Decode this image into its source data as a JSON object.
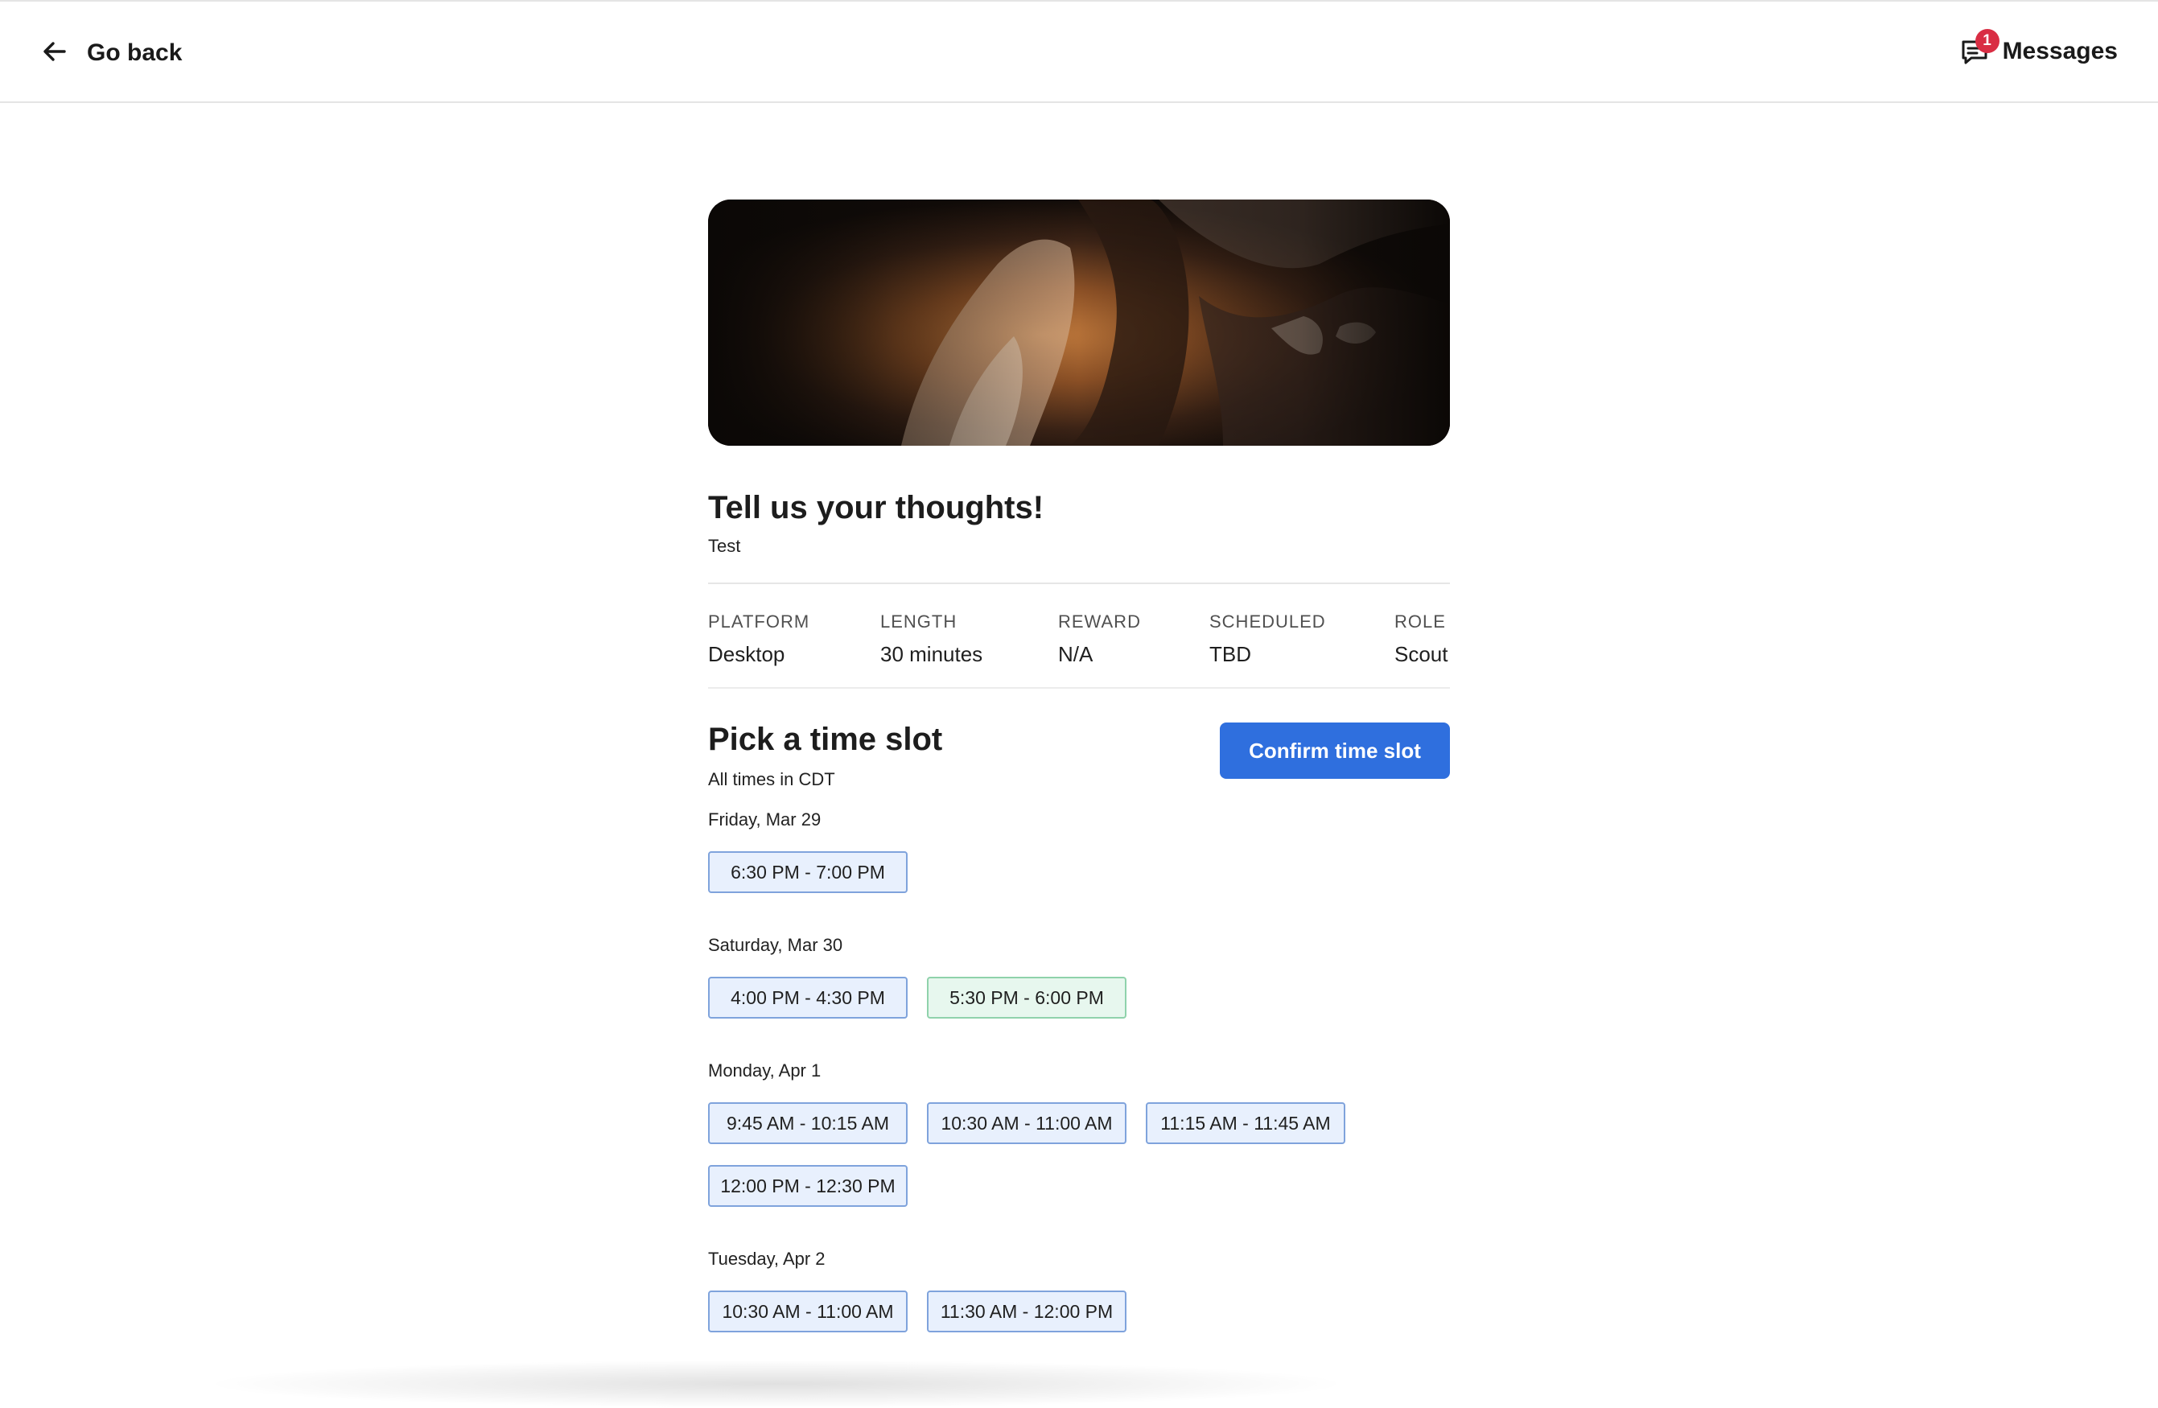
{
  "header": {
    "back_label": "Go back",
    "messages_label": "Messages",
    "messages_badge": "1"
  },
  "study": {
    "title": "Tell us your thoughts!",
    "subtitle": "Test",
    "meta": [
      {
        "label": "PLATFORM",
        "value": "Desktop"
      },
      {
        "label": "LENGTH",
        "value": "30 minutes"
      },
      {
        "label": "REWARD",
        "value": "N/A"
      },
      {
        "label": "SCHEDULED",
        "value": "TBD"
      },
      {
        "label": "ROLE",
        "value": "Scout"
      }
    ]
  },
  "scheduler": {
    "title": "Pick a time slot",
    "timezone_note": "All times in CDT",
    "confirm_label": "Confirm time slot",
    "days": [
      {
        "label": "Friday, Mar 29",
        "slots": [
          "6:30 PM - 7:00 PM"
        ]
      },
      {
        "label": "Saturday, Mar 30",
        "slots": [
          "4:00 PM - 4:30 PM",
          "5:30 PM - 6:00 PM"
        ]
      },
      {
        "label": "Monday, Apr 1",
        "slots": [
          "9:45 AM - 10:15 AM",
          "10:30 AM - 11:00 AM",
          "11:15 AM - 11:45 AM",
          "12:00 PM - 12:30 PM"
        ]
      },
      {
        "label": "Tuesday, Apr 2",
        "slots": [
          "10:30 AM - 11:00 AM",
          "11:30 AM - 12:00 PM"
        ]
      }
    ],
    "selected_slot": "5:30 PM - 6:00 PM"
  },
  "colors": {
    "accent": "#2f6fde",
    "badge": "#d92d43",
    "slot_bg": "#e8f0fd",
    "slot_selected_bg": "#e7f7ee"
  }
}
